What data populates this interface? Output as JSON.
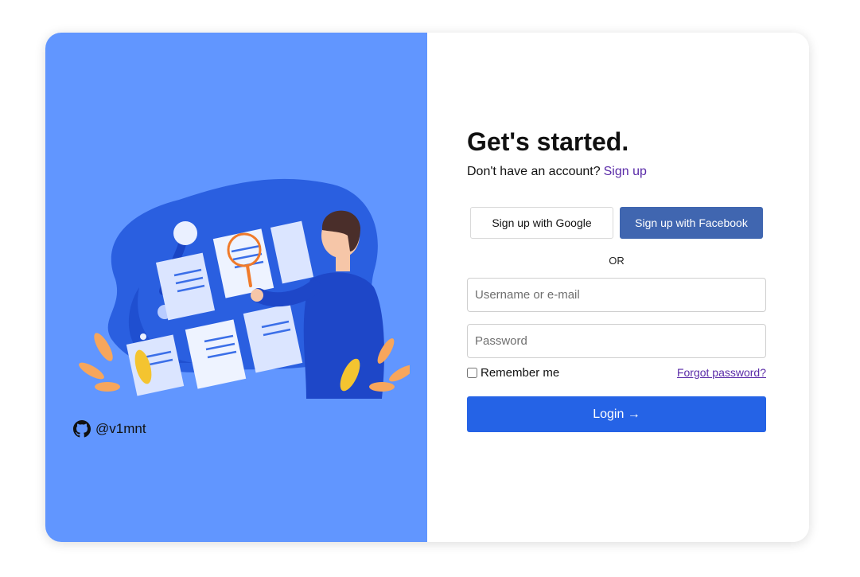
{
  "left_panel": {
    "credit_icon": "github-icon",
    "credit_text": "@v1mnt",
    "illustration": "person-reviewing-documents-illustration"
  },
  "form": {
    "title": "Get's started.",
    "subtitle_text": "Don't have an account?",
    "signup_link": "Sign up",
    "google_button": "Sign up with Google",
    "facebook_button": "Sign up with Facebook",
    "or_divider": "OR",
    "username_placeholder": "Username or e-mail",
    "password_placeholder": "Password",
    "remember_label": "Remember me",
    "remember_checked": false,
    "forgot_link": "Forgot password?",
    "login_button": "Login →"
  },
  "colors": {
    "left_panel_bg": "#6196ff",
    "facebook_blue": "#4066b0",
    "login_blue": "#2563e6",
    "link_purple": "#5a2ba8"
  }
}
